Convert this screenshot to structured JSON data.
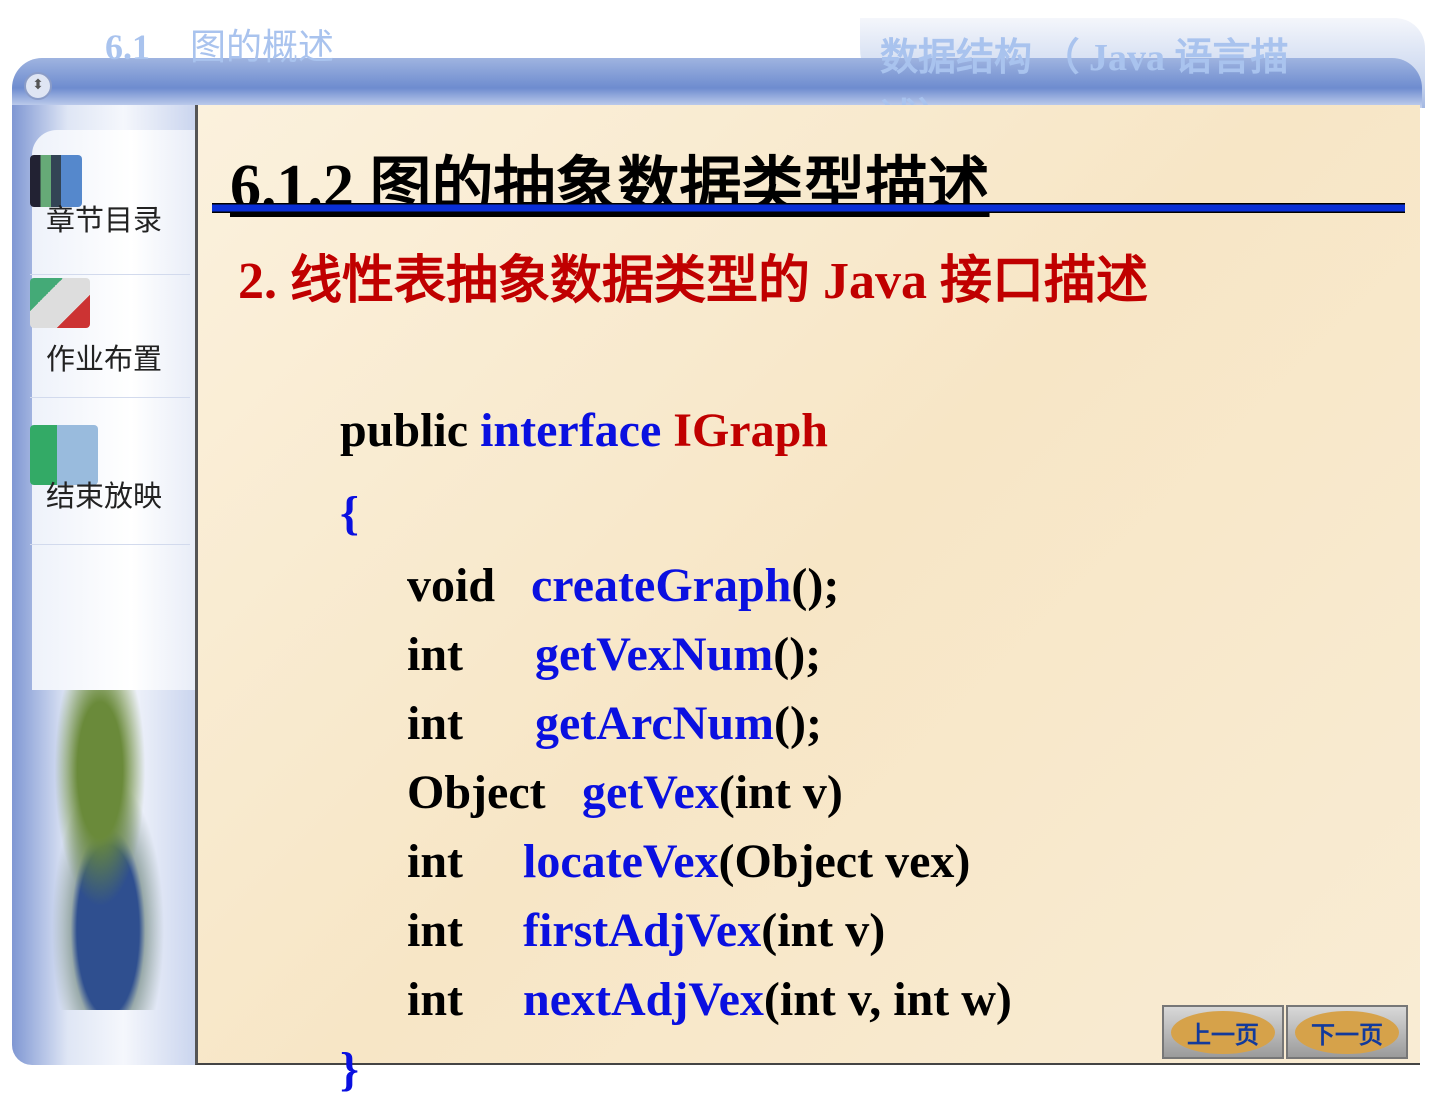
{
  "header": {
    "section_number": "6.1",
    "section_title": "图的概述",
    "book_title": "数据结构 （ Java 语言描述）"
  },
  "sidebar": {
    "items": [
      {
        "label": "章节目录",
        "icon": "book-icon"
      },
      {
        "label": "作业布置",
        "icon": "pen-paper-icon"
      },
      {
        "label": "结束放映",
        "icon": "exit-door-icon"
      }
    ]
  },
  "slide": {
    "title": "6.1.2 图的抽象数据类型描述",
    "subheading": "2. 线性表抽象数据类型的 Java 接口描述",
    "code": {
      "decl": {
        "mod": "public",
        "kw": "interface",
        "name": "IGraph"
      },
      "open": "{",
      "close": "}",
      "methods": [
        {
          "type": "void",
          "name": "createGraph",
          "args": "();"
        },
        {
          "type": "int",
          "name": "getVexNum",
          "args": "();"
        },
        {
          "type": "int",
          "name": "getArcNum",
          "args": "();"
        },
        {
          "type": "Object",
          "name": "getVex",
          "args": "(int v)"
        },
        {
          "type": "int",
          "name": "locateVex",
          "args": "(Object vex)"
        },
        {
          "type": "int",
          "name": "firstAdjVex",
          "args": "(int v)"
        },
        {
          "type": "int",
          "name": "nextAdjVex",
          "args": "(int v, int w)"
        }
      ]
    }
  },
  "nav": {
    "prev": "上一页",
    "next": "下一页"
  }
}
